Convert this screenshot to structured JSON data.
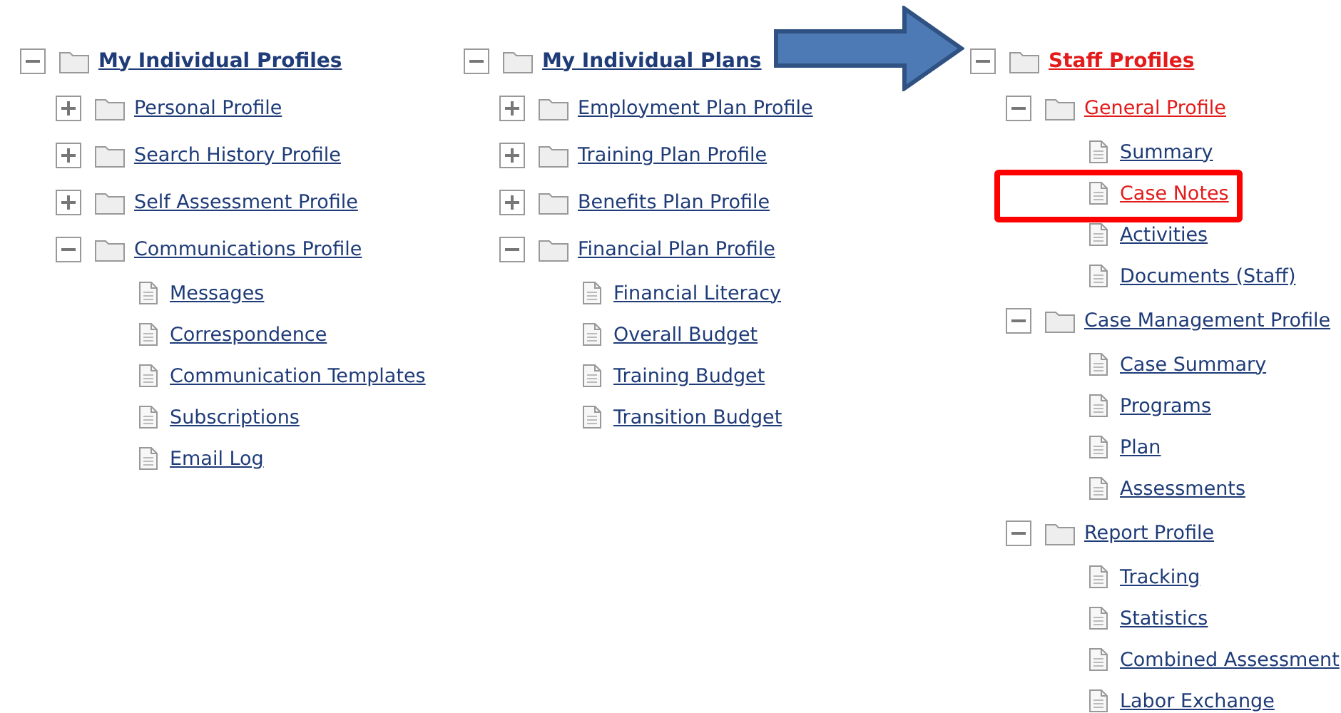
{
  "columns": [
    {
      "label": "My Individual Profiles",
      "expanded": true,
      "selected": false,
      "children": [
        {
          "kind": "folder",
          "label": "Personal Profile",
          "expanded": false,
          "selected": false
        },
        {
          "kind": "folder",
          "label": "Search History Profile",
          "expanded": false,
          "selected": false
        },
        {
          "kind": "folder",
          "label": "Self Assessment Profile",
          "expanded": false,
          "selected": false
        },
        {
          "kind": "folder",
          "label": "Communications Profile",
          "expanded": true,
          "selected": false,
          "children": [
            {
              "kind": "page",
              "label": "Messages",
              "selected": false,
              "highlighted": false
            },
            {
              "kind": "page",
              "label": "Correspondence",
              "selected": false,
              "highlighted": false
            },
            {
              "kind": "page",
              "label": "Communication Templates",
              "selected": false,
              "highlighted": false
            },
            {
              "kind": "page",
              "label": "Subscriptions",
              "selected": false,
              "highlighted": false
            },
            {
              "kind": "page",
              "label": "Email Log",
              "selected": false,
              "highlighted": false
            }
          ]
        }
      ]
    },
    {
      "label": "My Individual Plans",
      "expanded": true,
      "selected": false,
      "children": [
        {
          "kind": "folder",
          "label": "Employment Plan Profile",
          "expanded": false,
          "selected": false
        },
        {
          "kind": "folder",
          "label": "Training Plan Profile",
          "expanded": false,
          "selected": false
        },
        {
          "kind": "folder",
          "label": "Benefits Plan Profile",
          "expanded": false,
          "selected": false
        },
        {
          "kind": "folder",
          "label": "Financial Plan Profile",
          "expanded": true,
          "selected": false,
          "children": [
            {
              "kind": "page",
              "label": "Financial Literacy",
              "selected": false,
              "highlighted": false
            },
            {
              "kind": "page",
              "label": "Overall Budget",
              "selected": false,
              "highlighted": false
            },
            {
              "kind": "page",
              "label": "Training Budget",
              "selected": false,
              "highlighted": false
            },
            {
              "kind": "page",
              "label": "Transition Budget",
              "selected": false,
              "highlighted": false
            }
          ]
        }
      ]
    },
    {
      "label": "Staff Profiles",
      "expanded": true,
      "selected": true,
      "children": [
        {
          "kind": "folder",
          "label": "General Profile",
          "expanded": true,
          "selected": true,
          "children": [
            {
              "kind": "page",
              "label": "Summary",
              "selected": false,
              "highlighted": false
            },
            {
              "kind": "page",
              "label": "Case Notes",
              "selected": true,
              "highlighted": true
            },
            {
              "kind": "page",
              "label": "Activities",
              "selected": false,
              "highlighted": false
            },
            {
              "kind": "page",
              "label": "Documents (Staff)",
              "selected": false,
              "highlighted": false
            }
          ]
        },
        {
          "kind": "folder",
          "label": "Case Management Profile",
          "expanded": true,
          "selected": false,
          "children": [
            {
              "kind": "page",
              "label": "Case Summary",
              "selected": false,
              "highlighted": false
            },
            {
              "kind": "page",
              "label": "Programs",
              "selected": false,
              "highlighted": false
            },
            {
              "kind": "page",
              "label": "Plan",
              "selected": false,
              "highlighted": false
            },
            {
              "kind": "page",
              "label": "Assessments",
              "selected": false,
              "highlighted": false
            }
          ]
        },
        {
          "kind": "folder",
          "label": "Report Profile",
          "expanded": true,
          "selected": false,
          "children": [
            {
              "kind": "page",
              "label": "Tracking",
              "selected": false,
              "highlighted": false
            },
            {
              "kind": "page",
              "label": "Statistics",
              "selected": false,
              "highlighted": false
            },
            {
              "kind": "page",
              "label": "Combined Assessment",
              "selected": false,
              "highlighted": false
            },
            {
              "kind": "page",
              "label": "Labor Exchange",
              "selected": false,
              "highlighted": false
            }
          ]
        }
      ]
    }
  ]
}
